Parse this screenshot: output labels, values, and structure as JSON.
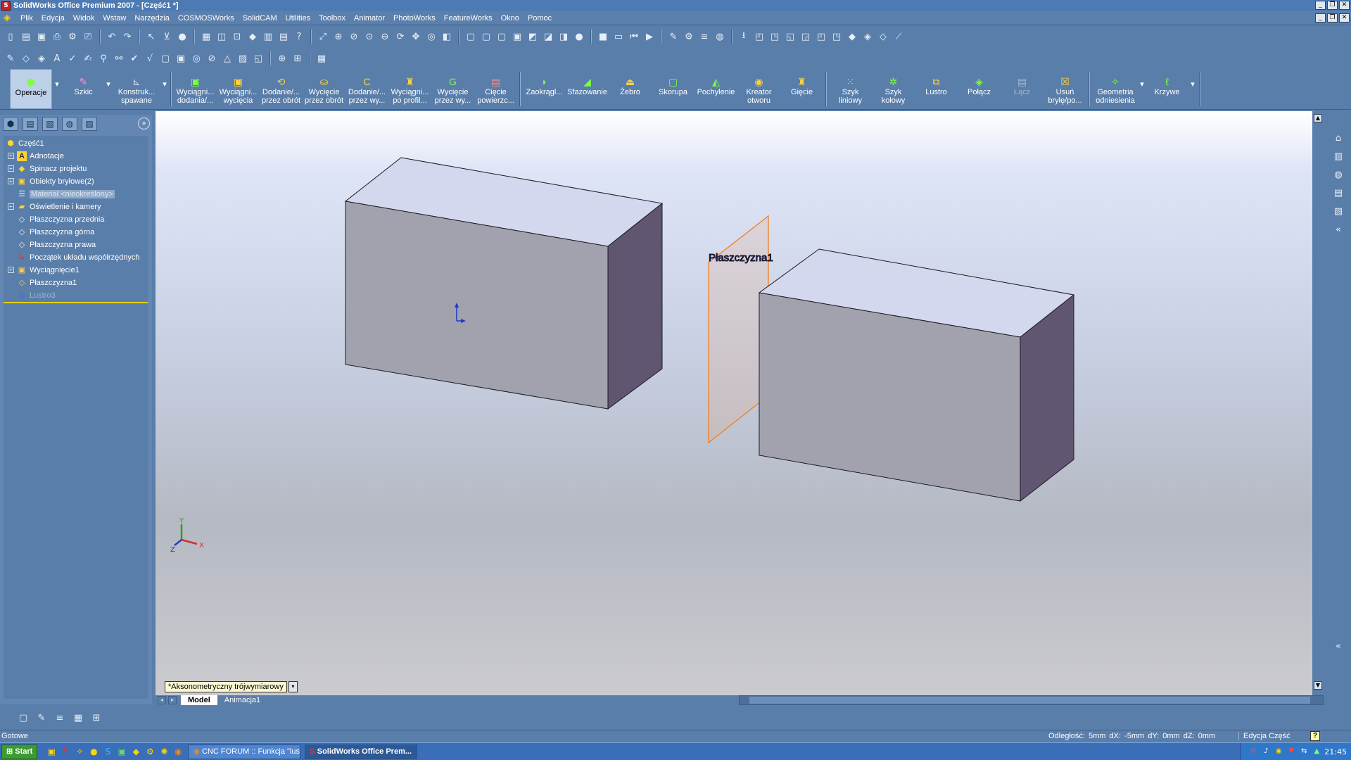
{
  "window": {
    "title": "SolidWorks Office Premium 2007 - [Część1 *]"
  },
  "menu": [
    "Plik",
    "Edycja",
    "Widok",
    "Wstaw",
    "Narzędzia",
    "COSMOSWorks",
    "SolidCAM",
    "Utilities",
    "Toolbox",
    "Animator",
    "PhotoWorks",
    "FeatureWorks",
    "Okno",
    "Pomoc"
  ],
  "command_manager": {
    "tabs": {
      "operations": "Operacje",
      "sketch": "Szkic",
      "weldments_1": "Konstruk...",
      "weldments_2": "spawane"
    },
    "features": [
      {
        "l1": "Wyciągni...",
        "l2": "dodania/..."
      },
      {
        "l1": "Wyciągni...",
        "l2": "wycięcia"
      },
      {
        "l1": "Dodanie/...",
        "l2": "przez obrót"
      },
      {
        "l1": "Wycięcie",
        "l2": "przez obrót"
      },
      {
        "l1": "Dodanie/...",
        "l2": "przez wy..."
      },
      {
        "l1": "Wyciągni...",
        "l2": "po profil..."
      },
      {
        "l1": "Wycięcie",
        "l2": "przez wy..."
      },
      {
        "l1": "Cięcie",
        "l2": "powierzc..."
      },
      {
        "l1": "Zaokrągl...",
        "l2": ""
      },
      {
        "l1": "Sfazowanie",
        "l2": ""
      },
      {
        "l1": "Żebro",
        "l2": ""
      },
      {
        "l1": "Skorupa",
        "l2": ""
      },
      {
        "l1": "Pochylenie",
        "l2": ""
      },
      {
        "l1": "Kreator",
        "l2": "otworu"
      },
      {
        "l1": "Gięcie",
        "l2": ""
      },
      {
        "l1": "Szyk",
        "l2": "liniowy"
      },
      {
        "l1": "Szyk",
        "l2": "kołowy"
      },
      {
        "l1": "Lustro",
        "l2": ""
      },
      {
        "l1": "Połącz",
        "l2": ""
      },
      {
        "l1": "Łącz",
        "l2": ""
      },
      {
        "l1": "Usuń",
        "l2": "bryłę/po..."
      },
      {
        "l1": "Geometria",
        "l2": "odniesienia"
      },
      {
        "l1": "Krzywe",
        "l2": ""
      }
    ]
  },
  "tree": {
    "root": "Część1",
    "items": [
      {
        "label": "Adnotacje",
        "icon": "annotation-icon",
        "expandable": true
      },
      {
        "label": "Spinacz projektu",
        "icon": "design-binder-icon",
        "expandable": true
      },
      {
        "label": "Obiekty bryłowe(2)",
        "icon": "solid-bodies-icon",
        "expandable": true
      },
      {
        "label": "Materiał <nieokreślony>",
        "icon": "material-icon",
        "expandable": false
      },
      {
        "label": "Oświetlenie i kamery",
        "icon": "lights-icon",
        "expandable": true
      },
      {
        "label": "Płaszczyzna przednia",
        "icon": "plane-icon",
        "expandable": false
      },
      {
        "label": "Płaszczyzna górna",
        "icon": "plane-icon",
        "expandable": false
      },
      {
        "label": "Płaszczyzna prawa",
        "icon": "plane-icon",
        "expandable": false
      },
      {
        "label": "Początek układu współrzędnych",
        "icon": "origin-icon",
        "expandable": false
      },
      {
        "label": "Wyciągnięcie1",
        "icon": "extrude-icon",
        "expandable": true
      },
      {
        "label": "Płaszczyzna1",
        "icon": "plane-icon",
        "expandable": false
      },
      {
        "label": "Lustro3",
        "icon": "mirror-icon",
        "expandable": false
      }
    ]
  },
  "viewport": {
    "plane_label": "Płaszczyzna1",
    "view_orientation": "*Aksonometryczny trójwymiarowy",
    "triad": {
      "x": "X",
      "y": "Y",
      "z": "Z"
    },
    "colors": {
      "box_top": "#d4d8ee",
      "box_front": "#a2a2ae",
      "box_side": "#605672",
      "plane_edge": "#f08020",
      "plane_label": "#2020c0"
    }
  },
  "model_tabs": {
    "model": "Model",
    "animation": "Animacja1"
  },
  "status": {
    "ready": "Gotowe",
    "measure": "Odległość: 5mm   dX: -5mm  dY: 0mm  dZ: 0mm",
    "mode": "Edycja Część",
    "help": "?"
  },
  "taskbar": {
    "start": "Start",
    "tasks": [
      "CNC FORUM :: Funkcja \"lus...",
      "SolidWorks Office Prem..."
    ],
    "clock": "21:45"
  }
}
